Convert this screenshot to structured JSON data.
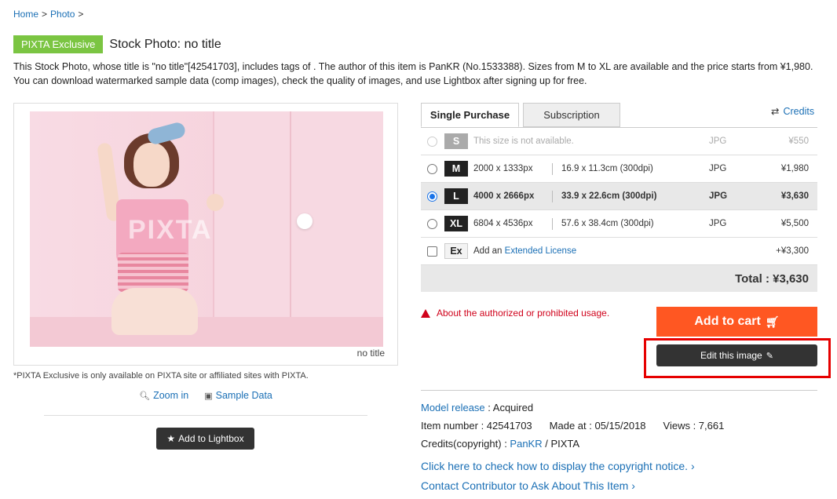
{
  "breadcrumb": {
    "home": "Home",
    "photo": "Photo",
    "sep": ">"
  },
  "badge": "PIXTA Exclusive",
  "page_title": "Stock Photo: no title",
  "description": "This Stock Photo, whose title is \"no title\"[42541703], includes tags of . The author of this item is PanKR (No.1533388). Sizes from M to XL are available and the price starts from ¥1,980. You can download watermarked sample data (comp images), check the quality of images, and use Lightbox after signing up for free.",
  "image": {
    "watermark": "PIXTA",
    "caption": "no title"
  },
  "exclusive_note": "*PIXTA Exclusive is only available on PIXTA site or affiliated sites with PIXTA.",
  "image_actions": {
    "zoom": "Zoom in",
    "sample": "Sample Data"
  },
  "lightbox_button": "Add to Lightbox",
  "tabs": [
    {
      "label": "Single Purchase"
    },
    {
      "label": "Subscription"
    }
  ],
  "credits_link": "Credits",
  "sizes": [
    {
      "size": "S",
      "px": "This size is not available.",
      "cm": "",
      "format": "JPG",
      "price": "¥550"
    },
    {
      "size": "M",
      "px": "2000 x 1333px",
      "cm": "16.9 x 11.3cm (300dpi)",
      "format": "JPG",
      "price": "¥1,980"
    },
    {
      "size": "L",
      "px": "4000 x 2666px",
      "cm": "33.9 x 22.6cm (300dpi)",
      "format": "JPG",
      "price": "¥3,630"
    },
    {
      "size": "XL",
      "px": "6804 x 4536px",
      "cm": "57.6 x 38.4cm (300dpi)",
      "format": "JPG",
      "price": "¥5,500"
    }
  ],
  "extended": {
    "size": "Ex",
    "prefix": "Add an",
    "link": "Extended License",
    "price": "+¥3,300"
  },
  "total": "Total : ¥3,630",
  "warning": "About the authorized or prohibited usage.",
  "cart_button": "Add to cart",
  "edit_button": "Edit this image",
  "meta": {
    "model_release_label": "Model release",
    "model_release_value": " : Acquired",
    "item_number": "Item number : 42541703",
    "made_at": "Made at : 05/15/2018",
    "views": "Views : 7,661",
    "credits_label": "Credits(copyright) : ",
    "author": "PanKR",
    "credits_suffix": " / PIXTA"
  },
  "links": {
    "copyright_notice": "Click here to check how to display the copyright notice. ›",
    "contact": "Contact Contributor to Ask About This Item ›"
  },
  "colors": {
    "accent": "#ff5722",
    "badge": "#7bc542",
    "link": "#1a6fb5",
    "warning": "#d0021b",
    "highlight": "#e60000"
  }
}
